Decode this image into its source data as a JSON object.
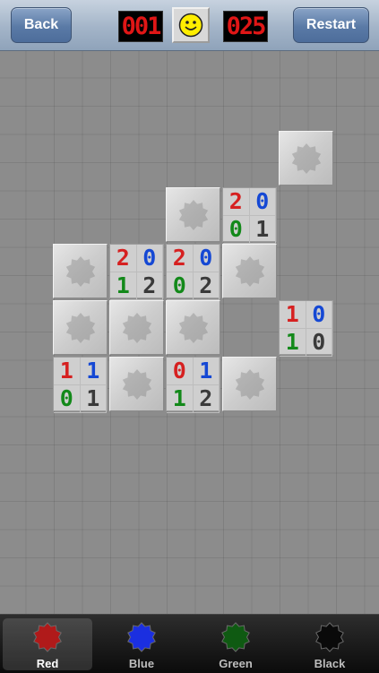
{
  "header": {
    "back_label": "Back",
    "restart_label": "Restart",
    "counter_left": "001",
    "counter_right": "025",
    "face_icon": "smiley-face-icon"
  },
  "board": {
    "covered_cells": [
      {
        "row": 0,
        "col": 5
      },
      {
        "row": 1,
        "col": 3
      },
      {
        "row": 2,
        "col": 1
      },
      {
        "row": 2,
        "col": 4
      },
      {
        "row": 3,
        "col": 1
      },
      {
        "row": 3,
        "col": 2
      },
      {
        "row": 3,
        "col": 3
      },
      {
        "row": 4,
        "col": 2
      },
      {
        "row": 4,
        "col": 4
      }
    ],
    "revealed_cells": [
      {
        "row": 1,
        "col": 4,
        "counts": {
          "red": "2",
          "blue": "0",
          "green": "0",
          "black": "1"
        }
      },
      {
        "row": 2,
        "col": 2,
        "counts": {
          "red": "2",
          "blue": "0",
          "green": "1",
          "black": "2"
        }
      },
      {
        "row": 2,
        "col": 3,
        "counts": {
          "red": "2",
          "blue": "0",
          "green": "0",
          "black": "2"
        }
      },
      {
        "row": 3,
        "col": 5,
        "counts": {
          "red": "1",
          "blue": "0",
          "green": "1",
          "black": "0"
        }
      },
      {
        "row": 4,
        "col": 1,
        "counts": {
          "red": "1",
          "blue": "1",
          "green": "0",
          "black": "1"
        }
      },
      {
        "row": 4,
        "col": 3,
        "counts": {
          "red": "0",
          "blue": "1",
          "green": "1",
          "black": "2"
        }
      }
    ]
  },
  "colors": {
    "red": "#d62020",
    "blue": "#1548d4",
    "green": "#13891a",
    "black": "#3a3a3a"
  },
  "tabs": [
    {
      "id": "red",
      "label": "Red",
      "color": "#b01a1a",
      "selected": true
    },
    {
      "id": "blue",
      "label": "Blue",
      "color": "#1b2fe0",
      "selected": false
    },
    {
      "id": "green",
      "label": "Green",
      "color": "#0f5a12",
      "selected": false
    },
    {
      "id": "black",
      "label": "Black",
      "color": "#0a0a0a",
      "selected": false
    }
  ]
}
